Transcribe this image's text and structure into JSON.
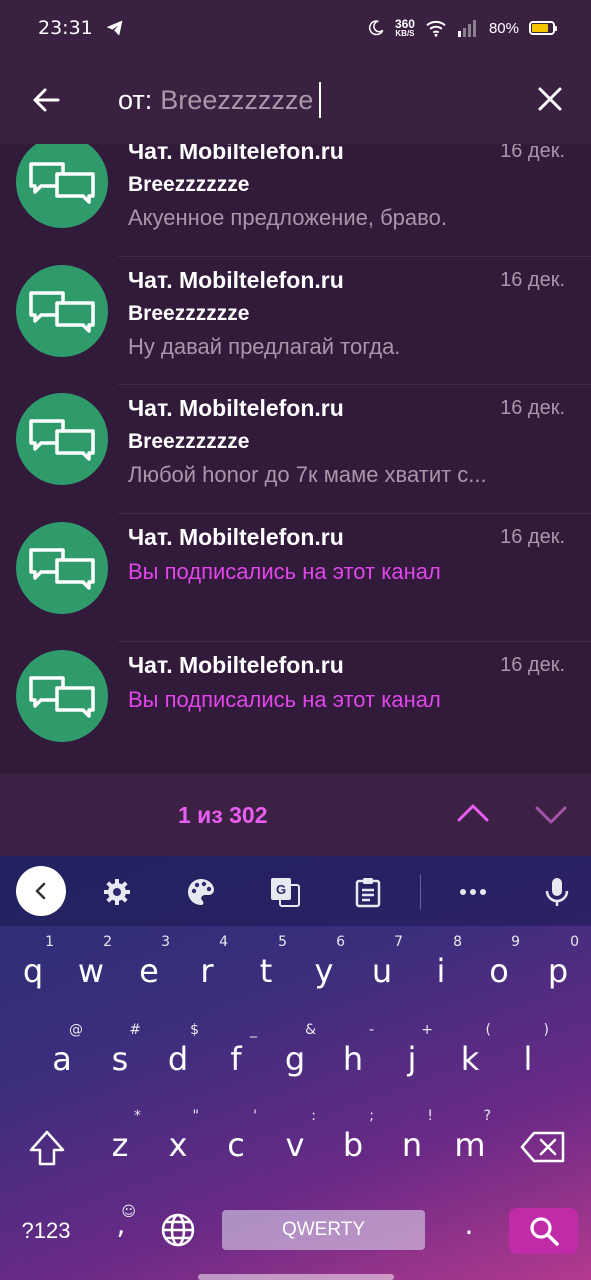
{
  "status_bar": {
    "time": "23:31",
    "net_speed_value": "360",
    "net_speed_unit": "KB/S",
    "battery": "80%"
  },
  "search": {
    "prefix": "от:",
    "value": "Breezzzzzze"
  },
  "results": [
    {
      "title": "Чат. Mobiltelefon.ru",
      "date": "16 дек.",
      "sender": "Breezzzzzze",
      "preview": "Акуенное предложение, браво."
    },
    {
      "title": "Чат. Mobiltelefon.ru",
      "date": "16 дек.",
      "sender": "Breezzzzzze",
      "preview": "Ну давай предлагай тогда."
    },
    {
      "title": "Чат. Mobiltelefon.ru",
      "date": "16 дек.",
      "sender": "Breezzzzzze",
      "preview": "Любой honor до 7к маме хватит с..."
    },
    {
      "title": "Чат. Mobiltelefon.ru",
      "date": "16 дек.",
      "system": "Вы подписались на этот канал"
    },
    {
      "title": "Чат. Mobiltelefon.ru",
      "date": "16 дек.",
      "system": "Вы подписались на этот канал"
    }
  ],
  "pager": {
    "count": "1 из 302"
  },
  "keyboard": {
    "row1": [
      {
        "k": "q",
        "h": "1"
      },
      {
        "k": "w",
        "h": "2"
      },
      {
        "k": "e",
        "h": "3"
      },
      {
        "k": "r",
        "h": "4"
      },
      {
        "k": "t",
        "h": "5"
      },
      {
        "k": "y",
        "h": "6"
      },
      {
        "k": "u",
        "h": "7"
      },
      {
        "k": "i",
        "h": "8"
      },
      {
        "k": "o",
        "h": "9"
      },
      {
        "k": "p",
        "h": "0"
      }
    ],
    "row2": [
      {
        "k": "a",
        "h": "@"
      },
      {
        "k": "s",
        "h": "#"
      },
      {
        "k": "d",
        "h": "$"
      },
      {
        "k": "f",
        "h": "_"
      },
      {
        "k": "g",
        "h": "&"
      },
      {
        "k": "h",
        "h": "-"
      },
      {
        "k": "j",
        "h": "+"
      },
      {
        "k": "k",
        "h": "("
      },
      {
        "k": "l",
        "h": ")"
      }
    ],
    "row3": [
      {
        "k": "z",
        "h": "*"
      },
      {
        "k": "x",
        "h": "\""
      },
      {
        "k": "c",
        "h": "'"
      },
      {
        "k": "v",
        "h": ":"
      },
      {
        "k": "b",
        "h": ";"
      },
      {
        "k": "n",
        "h": "!"
      },
      {
        "k": "m",
        "h": "?"
      }
    ],
    "symbols_label": "?123",
    "comma": ",",
    "period": ".",
    "space_label": "QWERTY"
  },
  "icons": {
    "back": "arrow-left-icon",
    "close": "close-icon",
    "avatar": "chat-bubbles-icon",
    "up": "chevron-up-icon",
    "down": "chevron-down-icon"
  },
  "colors": {
    "accent": "#e146ea",
    "avatar": "#2f9a6a",
    "search_key": "#c22ba8"
  }
}
